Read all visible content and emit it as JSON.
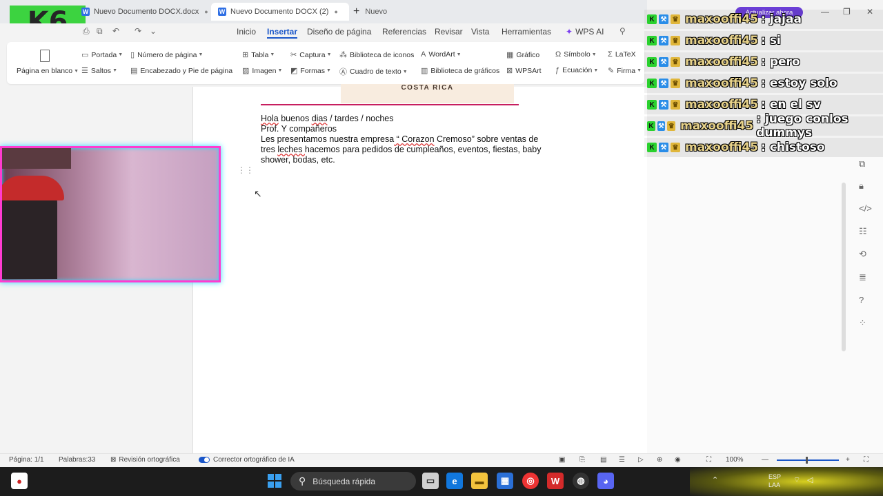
{
  "tabs": [
    {
      "label": "Nuevo Documento DOCX.docx",
      "active": false
    },
    {
      "label": "Nuevo Documento DOCX (2)",
      "active": true
    }
  ],
  "new_tab_label": "Nuevo",
  "menu": {
    "items": [
      "Inicio",
      "Insertar",
      "Diseño de página",
      "Referencias",
      "Revisar",
      "Vista",
      "Herramientas"
    ],
    "active": "Insertar",
    "wps_ai": "WPS AI"
  },
  "ribbon": {
    "blank_page": "Página en blanco",
    "cover": "Portada",
    "breaks": "Saltos",
    "page_number": "Número de página",
    "header_footer": "Encabezado y Pie de página",
    "table": "Tabla",
    "image": "Imagen",
    "capture": "Captura",
    "shapes": "Formas",
    "icon_library": "Biblioteca de iconos",
    "text_box": "Cuadro de texto",
    "wordart": "WordArt",
    "chart_library": "Biblioteca de gráficos",
    "chart": "Gráfico",
    "wpsart": "WPSArt",
    "symbol": "Símbolo",
    "equation": "Ecuación",
    "latex": "LaTeX",
    "signature": "Firma"
  },
  "document": {
    "banner": "COSTA RICA",
    "line1_a": "Hola",
    "line1_b": " buenos ",
    "line1_c": "dias",
    "line1_d": " / tardes / noches",
    "line2": "Prof. Y compañeros",
    "line3_a": "Les presentamos nuestra empresa",
    "line3_b": "  “ Corazon",
    "line3_c": " Cremoso”   sobre ventas de",
    "line4_a": "tres ",
    "line4_b": "leches ",
    "line4_c": "hacemos para pedidos de cumpleaños, eventos, fiestas, baby",
    "line5": "shower, bodas, etc."
  },
  "chat": {
    "update_button": "Actualizar ahora",
    "messages": [
      {
        "user": "maxooffi45",
        "text": ": jajaa"
      },
      {
        "user": "maxooffi45",
        "text": ": si"
      },
      {
        "user": "maxooffi45",
        "text": ": pero"
      },
      {
        "user": "maxooffi45",
        "text": ": estoy solo"
      },
      {
        "user": "maxooffi45",
        "text": ": en el sv"
      },
      {
        "user": "maxooffi45",
        "text": ": juego conlos dummys"
      },
      {
        "user": "maxooffi45",
        "text": ": chistoso"
      }
    ]
  },
  "statusbar": {
    "page": "Página: 1/1",
    "words": "Palabras:33",
    "spellcheck": "Revisión ortográfica",
    "ai_spellcheck": "Corrector ortográfico de IA",
    "zoom": "100%"
  },
  "taskbar": {
    "search_placeholder": "Búsqueda rápida",
    "lang_top": "ESP",
    "lang_bottom": "LAA"
  },
  "colors": {
    "accent": "#1a56c9",
    "pink_line": "#c71e5f",
    "webcam_border": "#ff3bd0",
    "logo_green": "#2ad12e"
  }
}
